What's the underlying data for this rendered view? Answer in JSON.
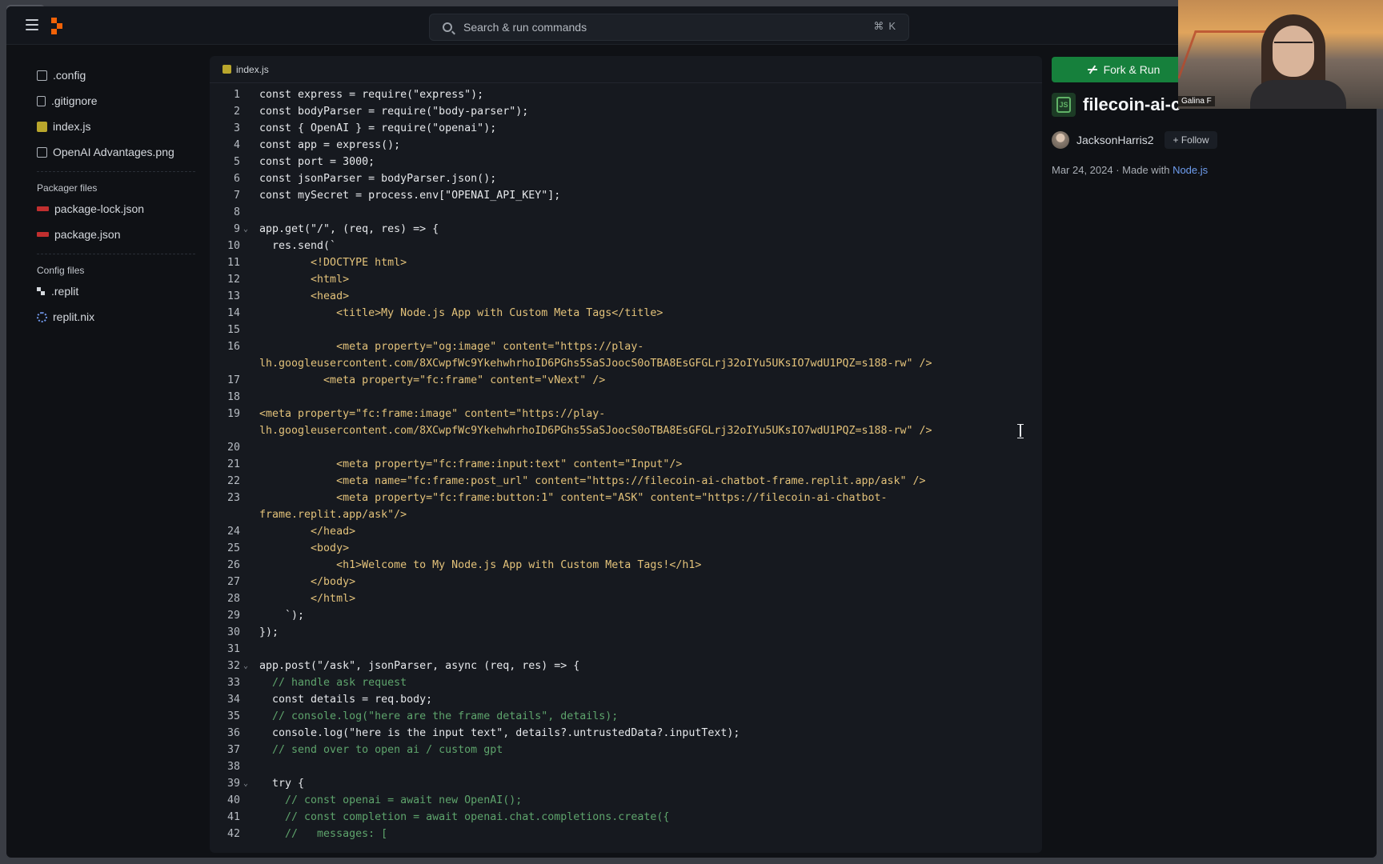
{
  "topbar": {
    "search_placeholder": "Search & run commands",
    "search_shortcut": "⌘K"
  },
  "sidebar": {
    "files": [
      {
        "name": ".config",
        "icon": "folder-icon"
      },
      {
        "name": ".gitignore",
        "icon": "file-icon"
      },
      {
        "name": "index.js",
        "icon": "js-file-icon"
      },
      {
        "name": "OpenAI Advantages.png",
        "icon": "image-file-icon"
      }
    ],
    "packager_label": "Packager files",
    "packager_files": [
      {
        "name": "package-lock.json",
        "icon": "npm-icon"
      },
      {
        "name": "package.json",
        "icon": "npm-icon"
      }
    ],
    "config_label": "Config files",
    "config_files": [
      {
        "name": ".replit",
        "icon": "replit-icon"
      },
      {
        "name": "replit.nix",
        "icon": "nix-icon"
      }
    ]
  },
  "editor": {
    "tab_label": "index.js",
    "lines": [
      {
        "n": "1",
        "text": "const express = require(\"express\");"
      },
      {
        "n": "2",
        "text": "const bodyParser = require(\"body-parser\");"
      },
      {
        "n": "3",
        "text": "const { OpenAI } = require(\"openai\");"
      },
      {
        "n": "4",
        "text": "const app = express();"
      },
      {
        "n": "5",
        "text": "const port = 3000;"
      },
      {
        "n": "6",
        "text": "const jsonParser = bodyParser.json();"
      },
      {
        "n": "7",
        "text": "const mySecret = process.env[\"OPENAI_API_KEY\"];"
      },
      {
        "n": "8",
        "text": ""
      },
      {
        "n": "9",
        "text": "app.get(\"/\", (req, res) => {",
        "fold": true
      },
      {
        "n": "10",
        "text": "  res.send(`"
      },
      {
        "n": "11",
        "text": "        <!DOCTYPE html>"
      },
      {
        "n": "12",
        "text": "        <html>"
      },
      {
        "n": "13",
        "text": "        <head>"
      },
      {
        "n": "14",
        "text": "            <title>My Node.js App with Custom Meta Tags</title>"
      },
      {
        "n": "15",
        "text": ""
      },
      {
        "n": "16",
        "text": "            <meta property=\"og:image\" content=\"https://play-"
      },
      {
        "n": "",
        "text": "lh.googleusercontent.com/8XCwpfWc9YkehwhrhoID6PGhs5SaSJoocS0oTBA8EsGFGLrj32oIYu5UKsIO7wdU1PQZ=s188-rw\" />"
      },
      {
        "n": "17",
        "text": "          <meta property=\"fc:frame\" content=\"vNext\" />"
      },
      {
        "n": "18",
        "text": ""
      },
      {
        "n": "19",
        "text": "<meta property=\"fc:frame:image\" content=\"https://play-"
      },
      {
        "n": "",
        "text": "lh.googleusercontent.com/8XCwpfWc9YkehwhrhoID6PGhs5SaSJoocS0oTBA8EsGFGLrj32oIYu5UKsIO7wdU1PQZ=s188-rw\" />"
      },
      {
        "n": "20",
        "text": ""
      },
      {
        "n": "21",
        "text": "            <meta property=\"fc:frame:input:text\" content=\"Input\"/>"
      },
      {
        "n": "22",
        "text": "            <meta name=\"fc:frame:post_url\" content=\"https://filecoin-ai-chatbot-frame.replit.app/ask\" />"
      },
      {
        "n": "23",
        "text": "            <meta property=\"fc:frame:button:1\" content=\"ASK\" content=\"https://filecoin-ai-chatbot-"
      },
      {
        "n": "",
        "text": "frame.replit.app/ask\"/>"
      },
      {
        "n": "24",
        "text": "        </head>"
      },
      {
        "n": "25",
        "text": "        <body>"
      },
      {
        "n": "26",
        "text": "            <h1>Welcome to My Node.js App with Custom Meta Tags!</h1>"
      },
      {
        "n": "27",
        "text": "        </body>"
      },
      {
        "n": "28",
        "text": "        </html>"
      },
      {
        "n": "29",
        "text": "    `);"
      },
      {
        "n": "30",
        "text": "});"
      },
      {
        "n": "31",
        "text": ""
      },
      {
        "n": "32",
        "text": "app.post(\"/ask\", jsonParser, async (req, res) => {",
        "fold": true
      },
      {
        "n": "33",
        "text": "  // handle ask request"
      },
      {
        "n": "34",
        "text": "  const details = req.body;"
      },
      {
        "n": "35",
        "text": "  // console.log(\"here are the frame details\", details);"
      },
      {
        "n": "36",
        "text": "  console.log(\"here is the input text\", details?.untrustedData?.inputText);"
      },
      {
        "n": "37",
        "text": "  // send over to open ai / custom gpt"
      },
      {
        "n": "38",
        "text": ""
      },
      {
        "n": "39",
        "text": "  try {",
        "fold": true
      },
      {
        "n": "40",
        "text": "    // const openai = await new OpenAI();"
      },
      {
        "n": "41",
        "text": "    // const completion = await openai.chat.completions.create({"
      },
      {
        "n": "42",
        "text": "    //   messages: ["
      }
    ]
  },
  "right_panel": {
    "fork_label": "Fork & Run",
    "repl_title": "filecoin-ai-c",
    "author": "JacksonHarris2",
    "follow_label": "Follow",
    "date": "Mar 24, 2024",
    "made_with_prefix": "· Made with",
    "made_with_link": "Node.js"
  },
  "webcam": {
    "name_tag": "Galina F"
  },
  "colors": {
    "accent_green": "#16803c",
    "link_blue": "#6f9ef0",
    "brand_orange": "#f26207"
  }
}
